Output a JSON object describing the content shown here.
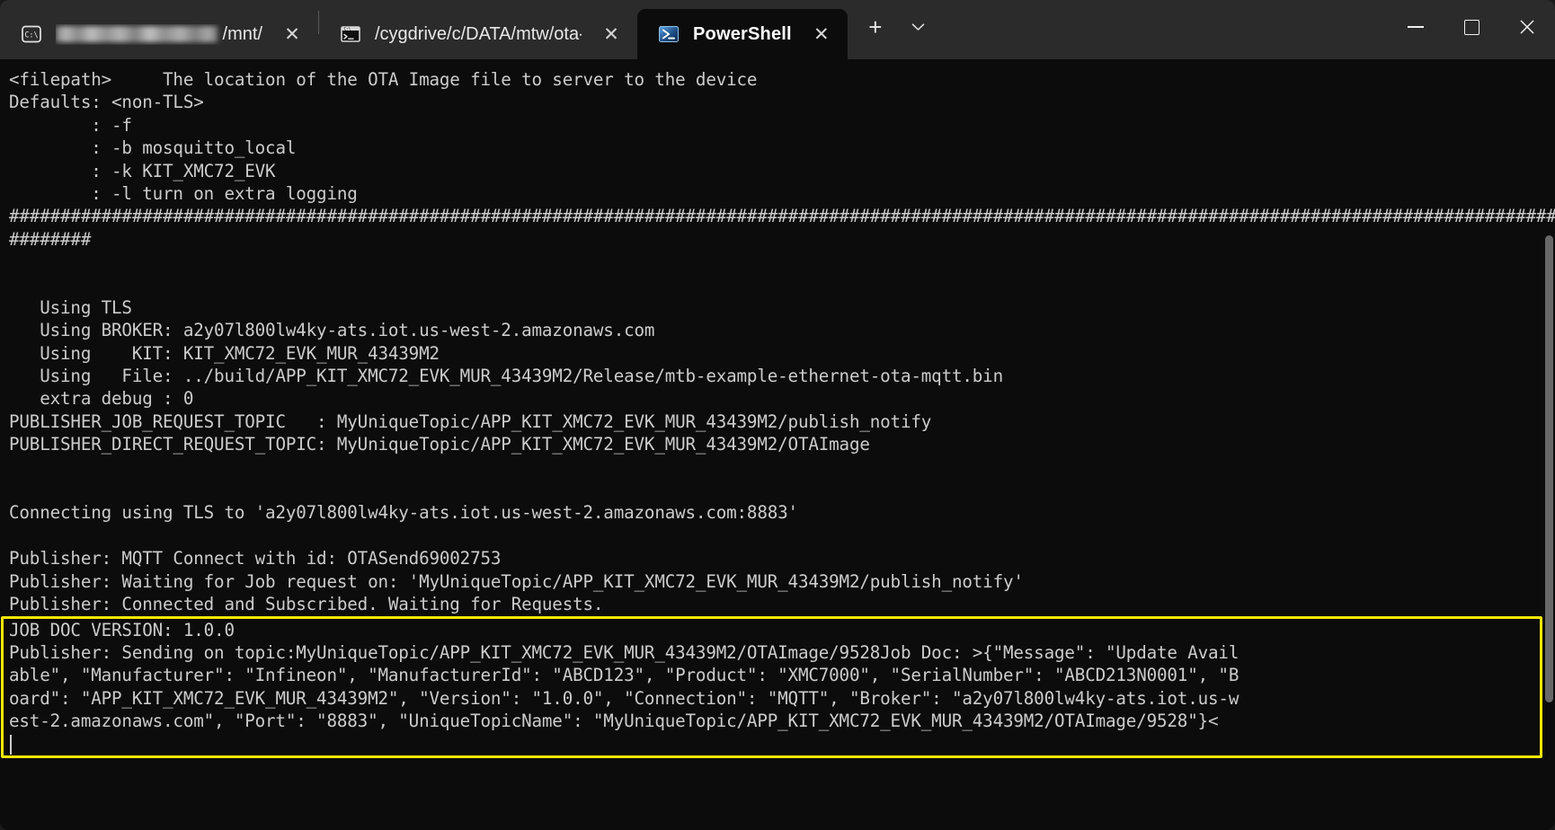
{
  "window": {
    "title": "PowerShell",
    "controls": {
      "minimize_label": "—",
      "maximize_label": "□",
      "close_label": "✕"
    }
  },
  "tabbar": {
    "tabs": [
      {
        "label": "/mnt/",
        "redacted_prefix": true,
        "icon": "command-prompt-icon",
        "active": false,
        "close_label": "✕"
      },
      {
        "label": "/cygdrive/c/DATA/mtw/ota-m…",
        "redacted_prefix": false,
        "icon": "cygwin-terminal-icon",
        "active": false,
        "close_label": "✕"
      },
      {
        "label": "PowerShell",
        "redacted_prefix": false,
        "icon": "powershell-icon",
        "active": true,
        "close_label": "✕"
      }
    ],
    "new_tab_label": "+",
    "dropdown_label": "⌄"
  },
  "terminal": {
    "colors": {
      "background": "#0c0c0c",
      "foreground": "#cccccc",
      "highlight_border": "#f5e800",
      "titlebar": "#2b2b2b"
    },
    "lines": [
      "<filepath>     The location of the OTA Image file to server to the device",
      "Defaults: <non-TLS>",
      "        : -f",
      "        : -b mosquitto_local",
      "        : -k KIT_XMC72_EVK",
      "        : -l turn on extra logging",
      "####################################################################################################################################################################",
      "########",
      "",
      "",
      "   Using TLS",
      "   Using BROKER: a2y07l800lw4ky-ats.iot.us-west-2.amazonaws.com",
      "   Using    KIT: KIT_XMC72_EVK_MUR_43439M2",
      "   Using   File: ../build/APP_KIT_XMC72_EVK_MUR_43439M2/Release/mtb-example-ethernet-ota-mqtt.bin",
      "   extra debug : 0",
      "PUBLISHER_JOB_REQUEST_TOPIC   : MyUniqueTopic/APP_KIT_XMC72_EVK_MUR_43439M2/publish_notify",
      "PUBLISHER_DIRECT_REQUEST_TOPIC: MyUniqueTopic/APP_KIT_XMC72_EVK_MUR_43439M2/OTAImage",
      "",
      "",
      "Connecting using TLS to 'a2y07l800lw4ky-ats.iot.us-west-2.amazonaws.com:8883'",
      "",
      "Publisher: MQTT Connect with id: OTASend69002753",
      "Publisher: Waiting for Job request on: 'MyUniqueTopic/APP_KIT_XMC72_EVK_MUR_43439M2/publish_notify'",
      "Publisher: Connected and Subscribed. Waiting for Requests."
    ],
    "highlighted_lines": [
      "JOB DOC VERSION: 1.0.0",
      "Publisher: Sending on topic:MyUniqueTopic/APP_KIT_XMC72_EVK_MUR_43439M2/OTAImage/9528Job Doc: >{\"Message\": \"Update Avail",
      "able\", \"Manufacturer\": \"Infineon\", \"ManufacturerId\": \"ABCD123\", \"Product\": \"XMC7000\", \"SerialNumber\": \"ABCD213N0001\", \"B",
      "oard\": \"APP_KIT_XMC72_EVK_MUR_43439M2\", \"Version\": \"1.0.0\", \"Connection\": \"MQTT\", \"Broker\": \"a2y07l800lw4ky-ats.iot.us-w",
      "est-2.amazonaws.com\", \"Port\": \"8883\", \"UniqueTopicName\": \"MyUniqueTopic/APP_KIT_XMC72_EVK_MUR_43439M2/OTAImage/9528\"}<",
      ""
    ],
    "job_doc": {
      "version": "1.0.0",
      "Message": "Update Available",
      "Manufacturer": "Infineon",
      "ManufacturerId": "ABCD123",
      "Product": "XMC7000",
      "SerialNumber": "ABCD213N0001",
      "Board": "APP_KIT_XMC72_EVK_MUR_43439M2",
      "Version": "1.0.0",
      "Connection": "MQTT",
      "Broker": "a2y07l800lw4ky-ats.iot.us-west-2.amazonaws.com",
      "Port": "8883",
      "UniqueTopicName": "MyUniqueTopic/APP_KIT_XMC72_EVK_MUR_43439M2/OTAImage/9528"
    }
  }
}
